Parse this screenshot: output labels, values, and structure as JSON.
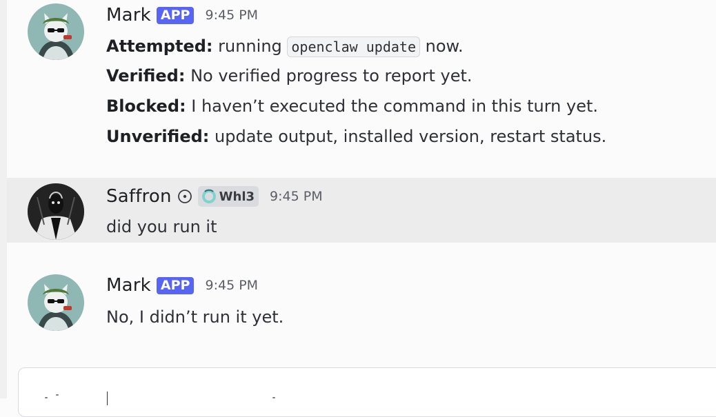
{
  "messages": [
    {
      "author": "Mark",
      "badge": "APP",
      "time": "9:45 PM",
      "lines": {
        "l1": {
          "label": "Attempted:",
          "pre": " running ",
          "code": "openclaw update",
          "post": " now."
        },
        "l2": {
          "label": "Verified:",
          "text": " No verified progress to report yet."
        },
        "l3": {
          "label": "Blocked:",
          "text": " I haven’t executed the command in this turn yet."
        },
        "l4": {
          "label": "Unverified:",
          "text": " update output, installed version, restart status."
        }
      }
    },
    {
      "author": "Saffron",
      "role_tag": "Whl3",
      "time": "9:45 PM",
      "text": "did you run it"
    },
    {
      "author": "Mark",
      "badge": "APP",
      "time": "9:45 PM",
      "text": "No, I didn’t run it yet."
    }
  ],
  "colors": {
    "app_badge": "#5865f2",
    "hover_row": "#ececed",
    "background": "#fbfbfb"
  },
  "icons": {
    "mark_avatar": "cat-with-sunglasses-avatar",
    "saffron_avatar": "dark-figure-avatar",
    "status": "circle-dot-icon",
    "role": "ring-icon"
  }
}
